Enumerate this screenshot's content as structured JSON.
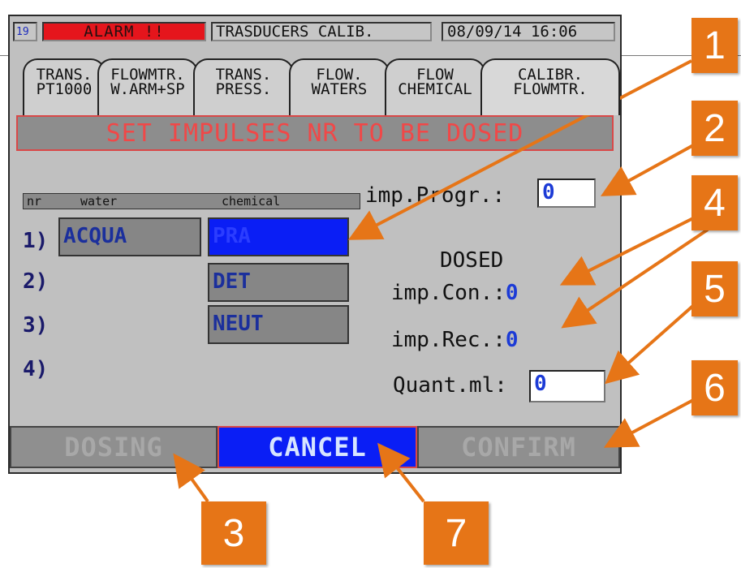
{
  "status_bar": {
    "alarm_number": "19",
    "alarm_text": "ALARM !!",
    "title": "TRASDUCERS CALIB.",
    "datetime": "08/09/14  16:06"
  },
  "tabs": [
    {
      "label": "TRANS.\nPT1000"
    },
    {
      "label": "FLOWMTR.\nW.ARM+SP"
    },
    {
      "label": "TRANS.\nPRESS."
    },
    {
      "label": "FLOW.\nWATERS"
    },
    {
      "label": "FLOW\nCHEMICAL"
    },
    {
      "label": "CALIBR.\nFLOWMTR.",
      "active": true
    }
  ],
  "banner": "SET IMPULSES NR TO BE DOSED",
  "table_header": {
    "nr": "nr",
    "water": "water",
    "chemical": "chemical"
  },
  "rows": [
    {
      "num": "1)",
      "water": "ACQUA",
      "chemical": "PRA"
    },
    {
      "num": "2)",
      "water": "",
      "chemical": "DET"
    },
    {
      "num": "3)",
      "water": "",
      "chemical": "NEUT"
    },
    {
      "num": "4)",
      "water": "",
      "chemical": ""
    }
  ],
  "imp_progr": {
    "label": "imp.Progr.:",
    "value": "0"
  },
  "dosed_title": "DOSED",
  "imp_con": {
    "label": "imp.Con.:",
    "value": "0"
  },
  "imp_rec": {
    "label": "imp.Rec.:",
    "value": "0"
  },
  "quant": {
    "label": "Quant.ml:",
    "value": "0"
  },
  "buttons": {
    "dosing": "DOSING",
    "cancel": "CANCEL",
    "confirm": "CONFIRM"
  },
  "callouts": [
    "1",
    "2",
    "3",
    "4",
    "5",
    "6",
    "7"
  ],
  "colors": {
    "alarm": "#e5151c",
    "selection": "#0a1ef5",
    "callout": "#e67517",
    "banner_text": "#f04848"
  }
}
